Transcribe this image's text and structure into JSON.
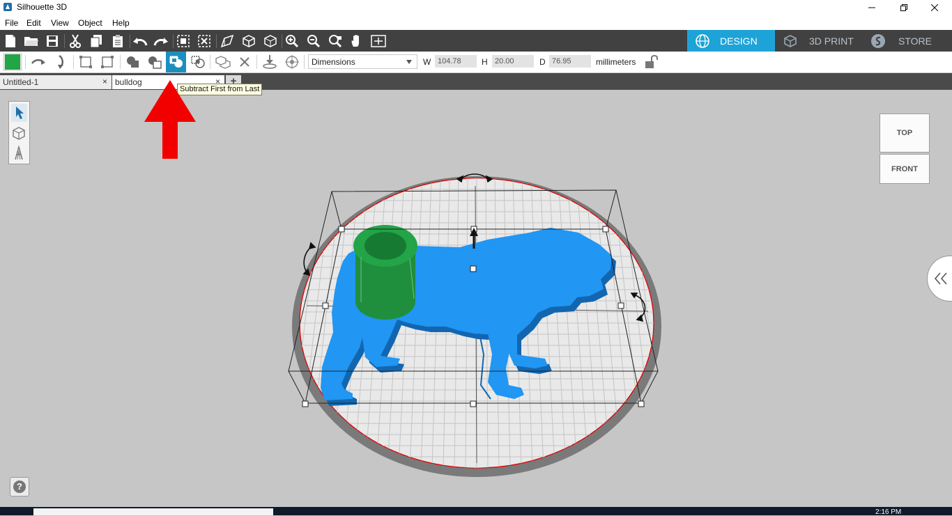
{
  "window": {
    "title": "Silhouette 3D"
  },
  "menu": [
    "File",
    "Edit",
    "View",
    "Object",
    "Help"
  ],
  "mode_tabs": {
    "design": "DESIGN",
    "print3d": "3D PRINT",
    "store": "STORE"
  },
  "dimensions": {
    "mode_select": "Dimensions",
    "w_label": "W",
    "w_value": "104.78",
    "h_label": "H",
    "h_value": "20.00",
    "d_label": "D",
    "d_value": "76.95",
    "units": "millimeters"
  },
  "doc_tabs": [
    {
      "label": "Untitled-1"
    },
    {
      "label": "bulldog"
    }
  ],
  "tab_close_symbol": "×",
  "new_tab_symbol": "+",
  "tooltip": "Subtract First from Last",
  "view_cube": {
    "top": "TOP",
    "front": "FRONT"
  },
  "help_symbol": "?",
  "taskbar": {
    "clock": "2:16 PM"
  },
  "colors": {
    "accent_tab": "#1ea3d8",
    "dark_toolbar": "#414141",
    "model_blue": "#2196f3",
    "cylinder_green": "#22a447",
    "annotation_red": "#f20000",
    "active_tool": "#1c8fbf"
  },
  "icons": {
    "toolbar_main": [
      "new-file-icon",
      "open-folder-icon",
      "save-icon",
      "cut-icon",
      "copy-icon",
      "paste-icon",
      "undo-icon",
      "redo-icon",
      "group-icon",
      "ungroup-icon",
      "extrude-icon",
      "cube-icon",
      "cube-outline-icon",
      "zoom-in-icon",
      "zoom-out-icon",
      "zoom-select-icon",
      "pan-hand-icon",
      "fit-page-icon"
    ],
    "toolbar_edit": [
      "color-swatch-icon",
      "flip-horizontal-icon",
      "flip-vertical-icon",
      "align-icon",
      "distribute-icon",
      "union-icon",
      "subtract-icon",
      "subtract-first-from-last-icon",
      "intersect-icon",
      "duplicate-icon",
      "delete-icon",
      "drop-to-floor-icon",
      "center-icon",
      "lock-icon"
    ]
  }
}
